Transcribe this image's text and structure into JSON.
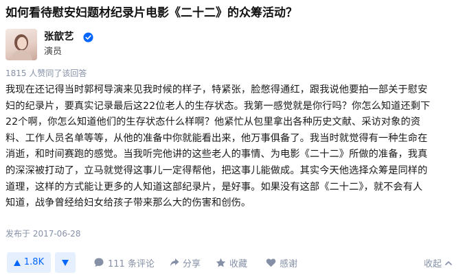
{
  "question": {
    "title": "如何看待慰安妇题材纪录片电影《二十二》的众筹活动？"
  },
  "author": {
    "name": "张歆艺",
    "title": "演员",
    "verified_icon": "verified-badge-icon"
  },
  "upvote_info": "1815 人赞同了该回答",
  "answer": {
    "lines": [
      "我现在还记得当时郭柯导演来见我时候的样子，特紧张，脸憋得通红，跟我说他要拍一部关于慰安",
      "妇的纪录片，要真实记录最后这22位老人的生存状态。我第一感觉就是你行吗？你怎么知道还剩下",
      "22个啊，你怎么知道他们的生存状态什么样啊？他紧忙从包里拿出各种历史文献、采访对象的资",
      "料、工作人员名单等等，从他的准备中你就能看出来，他万事俱备了。我当时就觉得有一种生命在",
      "消逝，和时间赛跑的感觉。当我听完他讲的这些老人的事情、为电影《二十二》所做的准备，我真",
      "的深深被打动了，立马就觉得这事儿一定得帮他，把这事儿能做成。其实今天他选择众筹是同样的",
      "道理，这样的方式能让更多的人知道这部纪录片，是好事。如果没有这部《二十二》，就不会有人",
      "知道，战争曾经给妇女给孩子带来那么大的伤害和创伤。"
    ]
  },
  "publish_date": "发布于 2017-06-28",
  "actions": {
    "upvote_count": "1.8K",
    "comments": "111 条评论",
    "share": "分享",
    "collect": "收藏",
    "thanks": "感谢",
    "collapse": "收起"
  },
  "colors": {
    "accent": "#0066ff",
    "accent_bg": "#e5effe",
    "muted": "#8590a6"
  }
}
